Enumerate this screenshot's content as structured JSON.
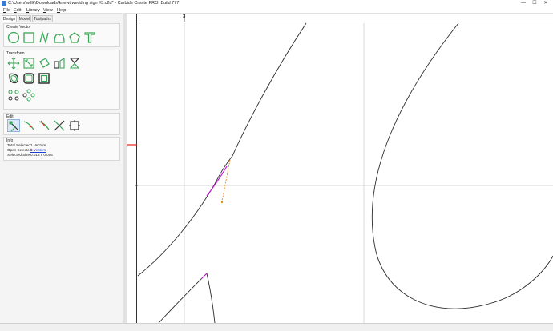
{
  "window": {
    "title": "C:\\Users\\willk\\Downloads\\knewt wedding sign #3.c2d* - Carbide Create PRO, Build 777",
    "minimize_glyph": "—",
    "maximize_glyph": "☐",
    "close_glyph": "✕"
  },
  "menu": {
    "items": [
      {
        "underline": "F",
        "rest": "ile"
      },
      {
        "underline": "E",
        "rest": "dit"
      },
      {
        "underline": "L",
        "rest": "ibrary"
      },
      {
        "underline": "V",
        "rest": "iew"
      },
      {
        "underline": "H",
        "rest": "elp"
      }
    ]
  },
  "tabs": [
    "Design",
    "Model",
    "Toolpaths"
  ],
  "groups": {
    "create_vector": "Create Vector",
    "transform": "Transform",
    "edit": "Edit",
    "info": "Info"
  },
  "tooltip": "Node Edit",
  "info": {
    "total_selected_label": "Total Selected:",
    "total_selected_value": "1 Vectors",
    "open_selected_label": "Open Selected:",
    "open_selected_value": "1 Vectors",
    "selected_size_label": "Selected Size:",
    "selected_size_value": "0.013 x 0.056"
  },
  "ruler": {
    "top_label": "3"
  },
  "colors": {
    "tool_green": "#3aa655",
    "accent_red": "#e0261c",
    "selection_magenta": "#c21bd1",
    "node_orange": "#f08a1c",
    "curve": "#2b2b2b",
    "grid": "#c8c8c8"
  }
}
